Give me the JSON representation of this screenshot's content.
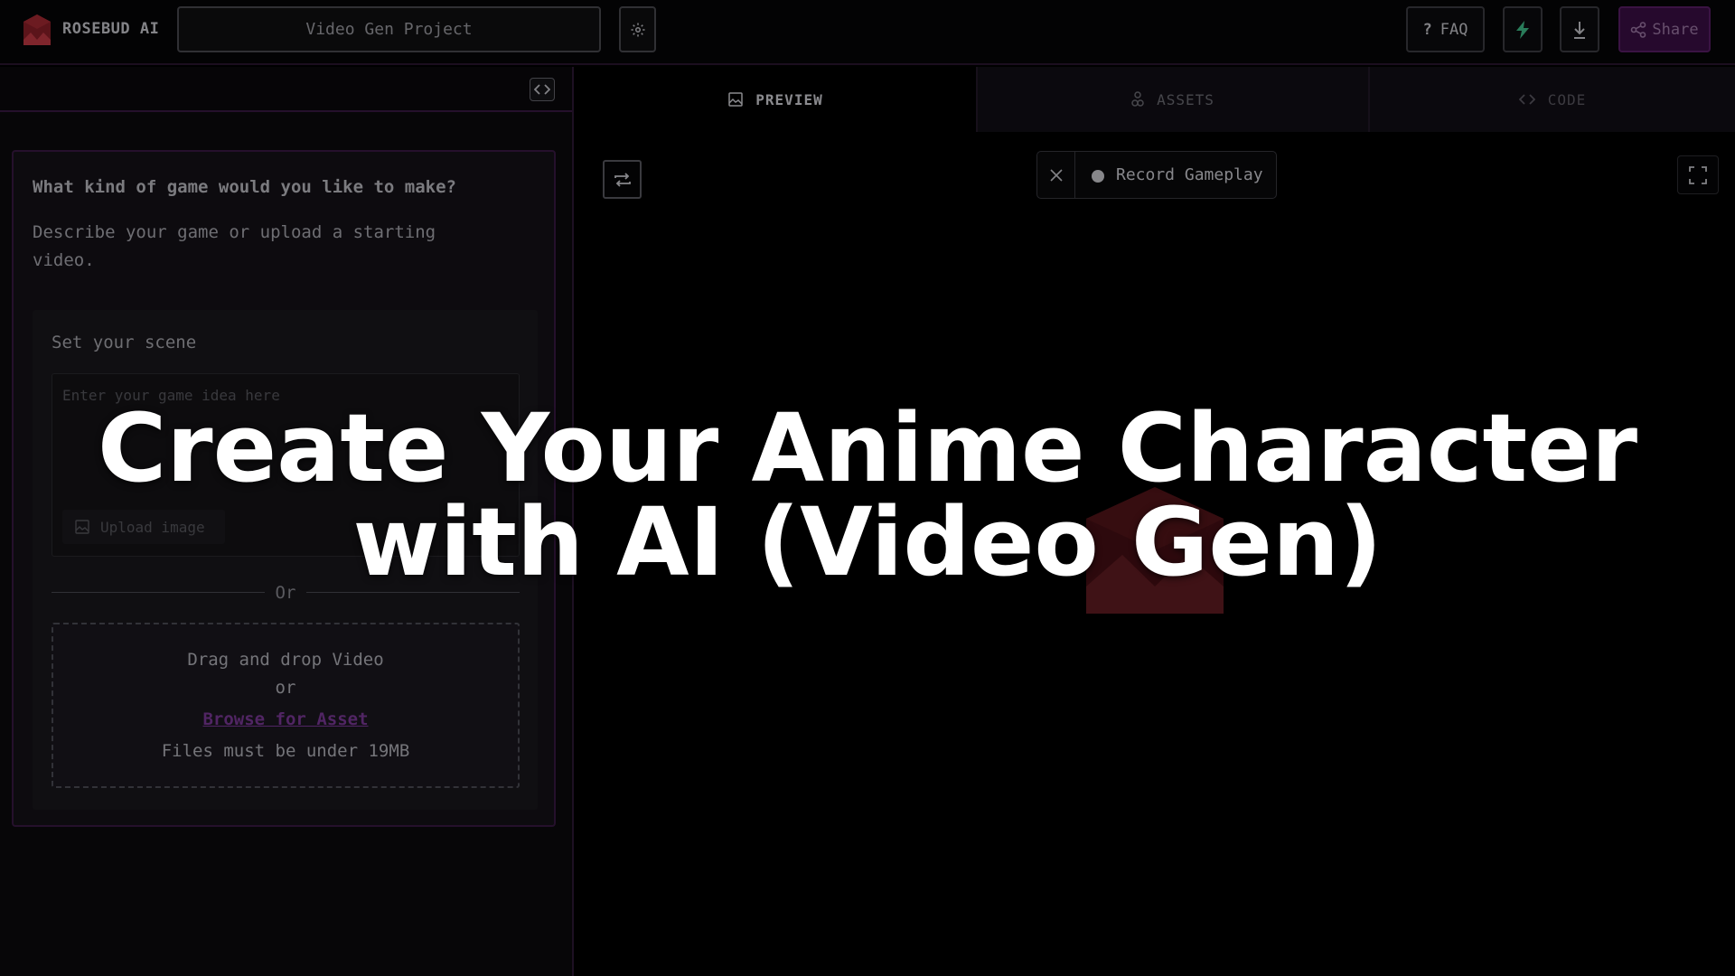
{
  "app": {
    "brand": "ROSEBUD AI",
    "project_name": "Video Gen Project"
  },
  "topbar": {
    "faq_label": "FAQ",
    "faq_glyph": "?",
    "share_label": "Share"
  },
  "tabs": {
    "preview": "PREVIEW",
    "assets": "ASSETS",
    "code": "CODE",
    "active": "preview"
  },
  "prompt_card": {
    "title": "What kind of game would you like to make?",
    "subtitle": "Describe your game or upload a starting video.",
    "scene_label": "Set your scene",
    "idea_placeholder": "Enter your game idea here",
    "upload_image_label": "Upload image",
    "or_divider": "Or",
    "dropzone": {
      "line1": "Drag and drop Video",
      "line2": "or",
      "browse_link": "Browse for Asset",
      "size_note": "Files must be under 19MB"
    }
  },
  "preview": {
    "record_label": "Record Gameplay"
  },
  "overlay": {
    "line1": "Create Your Anime Character",
    "line2": "with AI (Video Gen)"
  },
  "colors": {
    "brand_red": "#8c1f28",
    "accent_purple": "#5a1e68",
    "link_purple": "#7d3a9a",
    "bolt_green": "#3fbf8a"
  }
}
